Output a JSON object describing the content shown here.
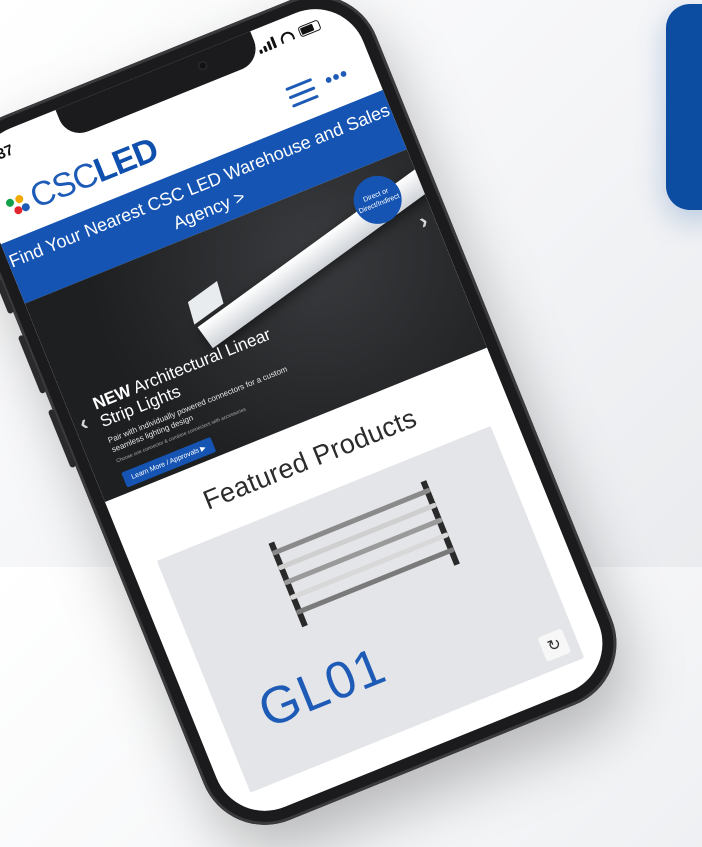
{
  "status_bar": {
    "time": "37"
  },
  "header": {
    "logo_csc": "CSC",
    "logo_led": "LED",
    "menu_icon": "hamburger-icon",
    "more_icon": "more-dots-icon",
    "more_glyph": "•••"
  },
  "banner": {
    "text": "Find Your Nearest CSC LED Warehouse and Sales Agency >"
  },
  "hero": {
    "badge": "Direct or Direct/Indirect",
    "title_bold": "NEW",
    "title_rest": " Architectural Linear Strip Lights",
    "subtitle": "Pair with individually powered connectors for a custom seamless lighting design",
    "fine_print": "Choose one connector & combine connectors with accessories",
    "button": "Learn More / Approvals ▶",
    "prev_arrow": "‹",
    "next_arrow": "›"
  },
  "featured": {
    "title": "Featured Products",
    "product_name": "GL01",
    "refresh_glyph": "↻"
  },
  "colors": {
    "brand_blue": "#1554b2",
    "logo_blue": "#1e5bb7",
    "bg_card": "#0d4da1"
  }
}
